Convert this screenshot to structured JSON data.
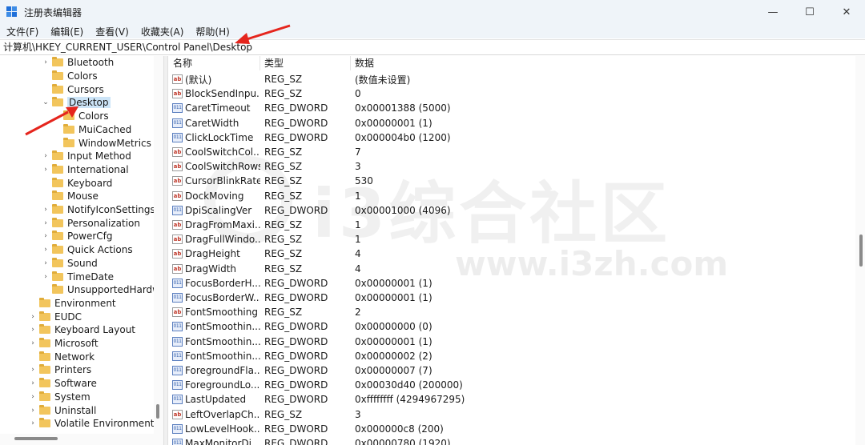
{
  "window": {
    "title": "注册表编辑器",
    "minimize_glyph": "—",
    "maximize_glyph": "☐",
    "close_glyph": "✕"
  },
  "menu": [
    "文件(F)",
    "编辑(E)",
    "查看(V)",
    "收藏夹(A)",
    "帮助(H)"
  ],
  "address": "计算机\\HKEY_CURRENT_USER\\Control Panel\\Desktop",
  "tree": [
    {
      "label": "Bluetooth",
      "chev": "›",
      "indent": 2
    },
    {
      "label": "Colors",
      "chev": "",
      "indent": 2
    },
    {
      "label": "Cursors",
      "chev": "",
      "indent": 2
    },
    {
      "label": "Desktop",
      "chev": "⌄",
      "indent": 2,
      "selected": true
    },
    {
      "label": "Colors",
      "chev": "",
      "indent": 3
    },
    {
      "label": "MuiCached",
      "chev": "",
      "indent": 3
    },
    {
      "label": "WindowMetrics",
      "chev": "",
      "indent": 3
    },
    {
      "label": "Input Method",
      "chev": "›",
      "indent": 2
    },
    {
      "label": "International",
      "chev": "›",
      "indent": 2
    },
    {
      "label": "Keyboard",
      "chev": "",
      "indent": 2
    },
    {
      "label": "Mouse",
      "chev": "",
      "indent": 2
    },
    {
      "label": "NotifyIconSettings",
      "chev": "›",
      "indent": 2
    },
    {
      "label": "Personalization",
      "chev": "›",
      "indent": 2
    },
    {
      "label": "PowerCfg",
      "chev": "›",
      "indent": 2
    },
    {
      "label": "Quick Actions",
      "chev": "›",
      "indent": 2
    },
    {
      "label": "Sound",
      "chev": "›",
      "indent": 2
    },
    {
      "label": "TimeDate",
      "chev": "›",
      "indent": 2
    },
    {
      "label": "UnsupportedHardw",
      "chev": "",
      "indent": 2
    },
    {
      "label": "Environment",
      "chev": "",
      "indent": 1
    },
    {
      "label": "EUDC",
      "chev": "›",
      "indent": 1
    },
    {
      "label": "Keyboard Layout",
      "chev": "›",
      "indent": 1
    },
    {
      "label": "Microsoft",
      "chev": "›",
      "indent": 1
    },
    {
      "label": "Network",
      "chev": "",
      "indent": 1
    },
    {
      "label": "Printers",
      "chev": "›",
      "indent": 1
    },
    {
      "label": "Software",
      "chev": "›",
      "indent": 1
    },
    {
      "label": "System",
      "chev": "›",
      "indent": 1
    },
    {
      "label": "Uninstall",
      "chev": "›",
      "indent": 1
    },
    {
      "label": "Volatile Environment",
      "chev": "›",
      "indent": 1
    }
  ],
  "list": {
    "headers": {
      "name": "名称",
      "type": "类型",
      "data": "数据"
    },
    "rows": [
      {
        "icon": "string",
        "name": "(默认)",
        "type": "REG_SZ",
        "data": "(数值未设置)"
      },
      {
        "icon": "string",
        "name": "BlockSendInpu...",
        "type": "REG_SZ",
        "data": "0"
      },
      {
        "icon": "binary",
        "name": "CaretTimeout",
        "type": "REG_DWORD",
        "data": "0x00001388 (5000)"
      },
      {
        "icon": "binary",
        "name": "CaretWidth",
        "type": "REG_DWORD",
        "data": "0x00000001 (1)"
      },
      {
        "icon": "binary",
        "name": "ClickLockTime",
        "type": "REG_DWORD",
        "data": "0x000004b0 (1200)"
      },
      {
        "icon": "string",
        "name": "CoolSwitchCol...",
        "type": "REG_SZ",
        "data": "7"
      },
      {
        "icon": "string",
        "name": "CoolSwitchRows",
        "type": "REG_SZ",
        "data": "3"
      },
      {
        "icon": "string",
        "name": "CursorBlinkRate",
        "type": "REG_SZ",
        "data": "530"
      },
      {
        "icon": "string",
        "name": "DockMoving",
        "type": "REG_SZ",
        "data": "1"
      },
      {
        "icon": "binary",
        "name": "DpiScalingVer",
        "type": "REG_DWORD",
        "data": "0x00001000 (4096)"
      },
      {
        "icon": "string",
        "name": "DragFromMaxi...",
        "type": "REG_SZ",
        "data": "1"
      },
      {
        "icon": "string",
        "name": "DragFullWindo...",
        "type": "REG_SZ",
        "data": "1"
      },
      {
        "icon": "string",
        "name": "DragHeight",
        "type": "REG_SZ",
        "data": "4"
      },
      {
        "icon": "string",
        "name": "DragWidth",
        "type": "REG_SZ",
        "data": "4"
      },
      {
        "icon": "binary",
        "name": "FocusBorderH...",
        "type": "REG_DWORD",
        "data": "0x00000001 (1)"
      },
      {
        "icon": "binary",
        "name": "FocusBorderW...",
        "type": "REG_DWORD",
        "data": "0x00000001 (1)"
      },
      {
        "icon": "string",
        "name": "FontSmoothing",
        "type": "REG_SZ",
        "data": "2"
      },
      {
        "icon": "binary",
        "name": "FontSmoothin...",
        "type": "REG_DWORD",
        "data": "0x00000000 (0)"
      },
      {
        "icon": "binary",
        "name": "FontSmoothin...",
        "type": "REG_DWORD",
        "data": "0x00000001 (1)"
      },
      {
        "icon": "binary",
        "name": "FontSmoothin...",
        "type": "REG_DWORD",
        "data": "0x00000002 (2)"
      },
      {
        "icon": "binary",
        "name": "ForegroundFla...",
        "type": "REG_DWORD",
        "data": "0x00000007 (7)"
      },
      {
        "icon": "binary",
        "name": "ForegroundLo...",
        "type": "REG_DWORD",
        "data": "0x00030d40 (200000)"
      },
      {
        "icon": "binary",
        "name": "LastUpdated",
        "type": "REG_DWORD",
        "data": "0xffffffff (4294967295)"
      },
      {
        "icon": "string",
        "name": "LeftOverlapCh...",
        "type": "REG_SZ",
        "data": "3"
      },
      {
        "icon": "binary",
        "name": "LowLevelHook...",
        "type": "REG_DWORD",
        "data": "0x000000c8 (200)"
      },
      {
        "icon": "binary",
        "name": "MaxMonitorDi...",
        "type": "REG_DWORD",
        "data": "0x00000780 (1920)"
      }
    ]
  },
  "watermark": {
    "text": "i3综合社区",
    "url": "www.i3zh.com"
  },
  "colors": {
    "annotation_arrow": "#e5251d",
    "selection": "#cce4f7",
    "folder": "#f2c55c"
  }
}
